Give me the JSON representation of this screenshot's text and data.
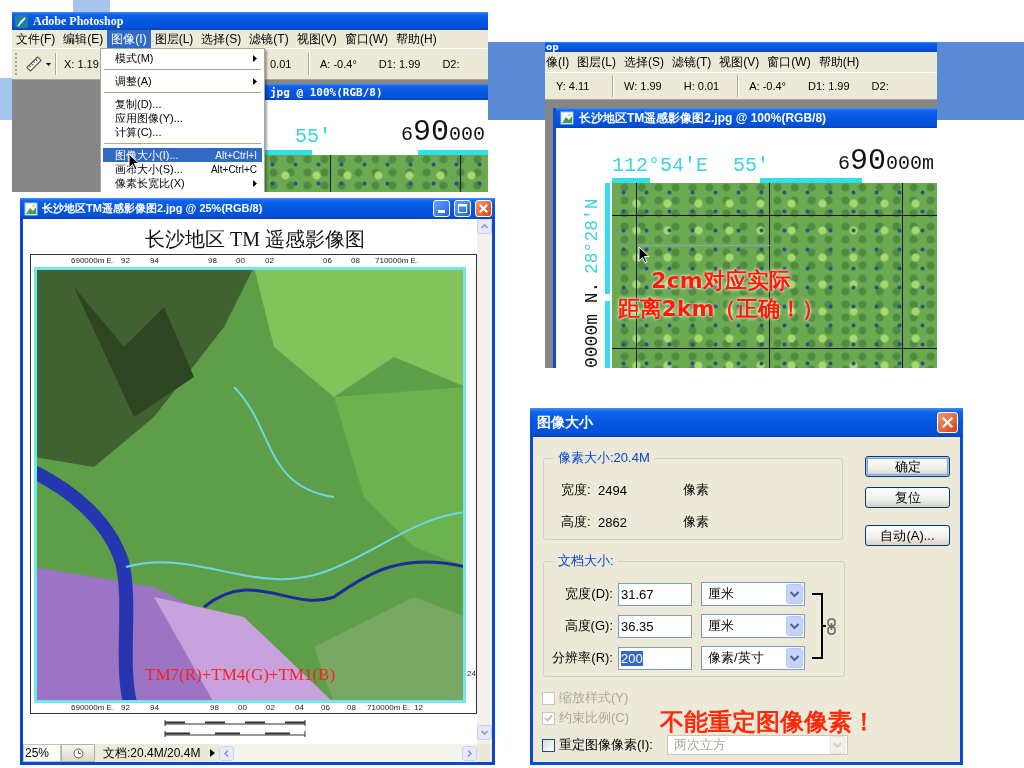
{
  "menu_shot": {
    "app_title": "Adobe Photoshop",
    "menu_bar": [
      {
        "label": "文件(F)",
        "selected": false
      },
      {
        "label": "编辑(E)",
        "selected": false
      },
      {
        "label": "图像(I)",
        "selected": true
      },
      {
        "label": "图层(L)",
        "selected": false
      },
      {
        "label": "选择(S)",
        "selected": false
      },
      {
        "label": "滤镜(T)",
        "selected": false
      },
      {
        "label": "视图(V)",
        "selected": false
      },
      {
        "label": "窗口(W)",
        "selected": false
      },
      {
        "label": "帮助(H)",
        "selected": false
      }
    ],
    "options_bar": [
      [
        "X: 1.19"
      ],
      [
        "0.01"
      ],
      [
        "A: -0.4°",
        "D1: 1.99",
        "D2:"
      ]
    ],
    "document": {
      "title": "jpg @ 100%(RGB/8)",
      "labels": [
        {
          "kind": "degree",
          "text": "55′"
        },
        {
          "kind": "meters",
          "lead": "6",
          "major": "90",
          "trail": "000"
        }
      ]
    },
    "dropdown": [
      [
        {
          "label": "模式(M)",
          "submenu": true,
          "selected": false
        }
      ],
      [
        {
          "label": "调整(A)",
          "submenu": true,
          "selected": false
        }
      ],
      [
        {
          "label": "复制(D)...",
          "submenu": false,
          "selected": false
        },
        {
          "label": "应用图像(Y)...",
          "submenu": false,
          "selected": false
        },
        {
          "label": "计算(C)...",
          "submenu": false,
          "selected": false
        }
      ],
      [
        {
          "label": "图像大小(I)...",
          "shortcut": "Alt+Ctrl+I",
          "submenu": false,
          "selected": true
        },
        {
          "label": "画布大小(S)...",
          "shortcut": "Alt+Ctrl+C",
          "submenu": false,
          "selected": false
        },
        {
          "label": "像素长宽比(X)",
          "submenu": true,
          "selected": false
        }
      ]
    ]
  },
  "measure_shot": {
    "app_title": "op",
    "menu_bar": [
      {
        "label": "像(I)",
        "selected": false
      },
      {
        "label": "图层(L)",
        "selected": false
      },
      {
        "label": "选择(S)",
        "selected": false
      },
      {
        "label": "滤镜(T)",
        "selected": false
      },
      {
        "label": "视图(V)",
        "selected": false
      },
      {
        "label": "窗口(W)",
        "selected": false
      },
      {
        "label": "帮助(H)",
        "selected": false
      }
    ],
    "options_bar": [
      [
        "Y: 4.11"
      ],
      [
        "W: 1.99",
        "H: 0.01"
      ],
      [
        "A: -0.4°",
        "D1: 1.99",
        "D2:"
      ]
    ],
    "document": {
      "title": "长沙地区TM遥感影像图2.jpg @ 100%(RGB/8)",
      "labels": [
        {
          "kind": "degree",
          "text": "112°54′E"
        },
        {
          "kind": "degree",
          "text": "55′"
        },
        {
          "kind": "meters",
          "lead": "6",
          "major": "90",
          "trail": "000m"
        }
      ],
      "side_labels": [
        {
          "kind": "meters",
          "text": "0000m N."
        },
        {
          "kind": "degree",
          "text": "28°28′N"
        }
      ],
      "annotation_lines": [
        "2cm对应实际",
        "距离2km（正确！）"
      ]
    }
  },
  "doc_window": {
    "title": "长沙地区TM遥感影像图2.jpg @ 25%(RGB/8)",
    "map_title": "长沙地区 TM 遥感影像图",
    "top_ticks": [
      "690000m E.",
      "92",
      "94",
      "98",
      "00",
      "02",
      "06",
      "08",
      "710000m E."
    ],
    "bottom_ticks": [
      "690000m E.",
      "92",
      "94",
      "98",
      "00",
      "02",
      "04",
      "06",
      "08",
      "710000m E.",
      "12"
    ],
    "side_ticks": [
      "24"
    ],
    "band_text": "TM7(R)+TM4(G)+TM1(B)",
    "status": {
      "zoom": "25%",
      "info": "文档:20.4M/20.4M"
    }
  },
  "dialog": {
    "title": "图像大小",
    "pixel_group": {
      "legend": "像素大小:20.4M",
      "rows": [
        {
          "label": "宽度:",
          "value": "2494",
          "unit": "像素"
        },
        {
          "label": "高度:",
          "value": "2862",
          "unit": "像素"
        }
      ]
    },
    "buttons": [
      {
        "label": "确定",
        "default": true
      },
      {
        "label": "复位",
        "default": false
      },
      {
        "label": "自动(A)...",
        "default": false
      }
    ],
    "document_group": {
      "legend": "文档大小:",
      "linked": true,
      "rows": [
        {
          "label": "宽度(D):",
          "value": "31.67",
          "unit": "厘米",
          "value_selected": false
        },
        {
          "label": "高度(G):",
          "value": "36.35",
          "unit": "厘米",
          "value_selected": false
        },
        {
          "label": "分辨率(R):",
          "value": "200",
          "unit": "像素/英寸",
          "value_selected": true
        }
      ]
    },
    "checkboxes": [
      {
        "label": "缩放样式(Y)",
        "checked": false,
        "disabled": true
      },
      {
        "label": "约束比例(C)",
        "checked": true,
        "disabled": true
      },
      {
        "label": "重定图像像素(I):",
        "checked": false,
        "disabled": false
      }
    ],
    "resample": {
      "value": "两次立方",
      "disabled": true
    },
    "annotation": "不能重定图像像素！"
  }
}
